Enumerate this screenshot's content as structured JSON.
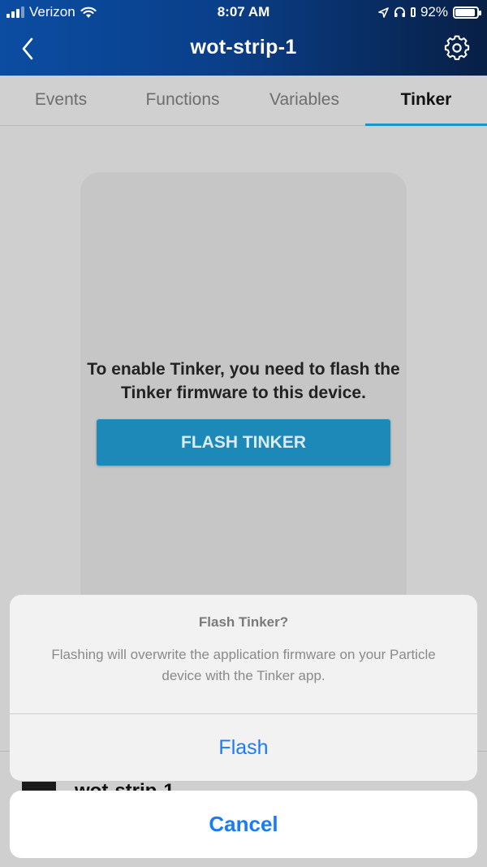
{
  "status_bar": {
    "carrier": "Verizon",
    "time": "8:07 AM",
    "battery": "92%"
  },
  "nav": {
    "title": "wot-strip-1"
  },
  "tabs": [
    {
      "label": "Events"
    },
    {
      "label": "Functions"
    },
    {
      "label": "Variables"
    },
    {
      "label": "Tinker"
    }
  ],
  "card": {
    "message": "To enable Tinker, you need to flash the Tinker firmware to this device.",
    "button_label": "FLASH TINKER"
  },
  "device": {
    "name": "wot-strip-1"
  },
  "action_sheet": {
    "title": "Flash Tinker?",
    "message": "Flashing will overwrite the application firmware on your Particle device with the Tinker app.",
    "action_label": "Flash",
    "cancel_label": "Cancel"
  },
  "colors": {
    "header_start": "#0b4da2",
    "header_end": "#081f45",
    "accent": "#1a95c8",
    "button": "#1d89b9",
    "ios_blue": "#1a7cf5"
  }
}
